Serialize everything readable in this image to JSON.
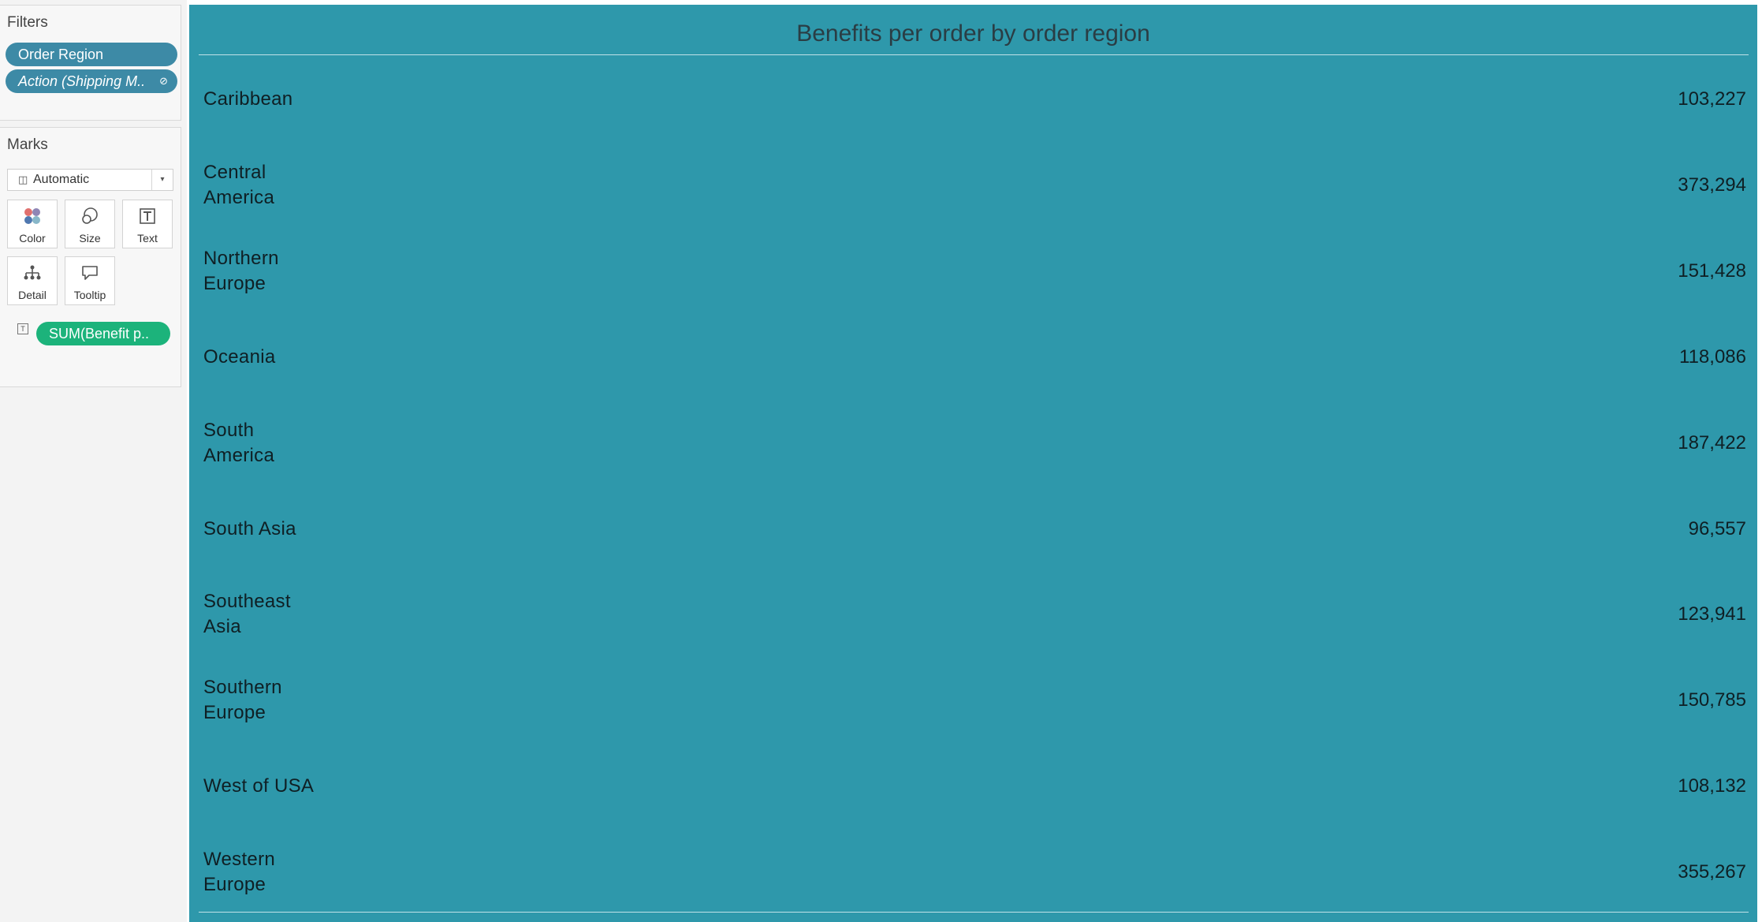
{
  "filters": {
    "title": "Filters",
    "pills": [
      {
        "label": "Order Region"
      },
      {
        "label": "Action (Shipping M..",
        "link_glyph": "⊘"
      }
    ]
  },
  "marks": {
    "title": "Marks",
    "mark_type": "Automatic",
    "buttons": [
      {
        "label": "Color",
        "icon": "color-dots-icon"
      },
      {
        "label": "Size",
        "icon": "size-circles-icon"
      },
      {
        "label": "Text",
        "icon": "text-t-icon"
      },
      {
        "label": "Detail",
        "icon": "detail-tree-icon"
      },
      {
        "label": "Tooltip",
        "icon": "tooltip-speech-icon"
      }
    ],
    "field_pill": "SUM(Benefit p.."
  },
  "colors": {
    "view_background": "#2e98ab",
    "filter_pill": "#3d8aa6",
    "measure_pill": "#1cb37b"
  },
  "chart_data": {
    "type": "table",
    "title": "Benefits per order by order region",
    "rows": [
      {
        "region": "Caribbean",
        "value": "103,227"
      },
      {
        "region": "Central America",
        "value": "373,294"
      },
      {
        "region": "Northern Europe",
        "value": "151,428"
      },
      {
        "region": "Oceania",
        "value": "118,086"
      },
      {
        "region": "South America",
        "value": "187,422"
      },
      {
        "region": "South Asia",
        "value": "96,557"
      },
      {
        "region": "Southeast Asia",
        "value": "123,941"
      },
      {
        "region": "Southern Europe",
        "value": "150,785"
      },
      {
        "region": "West of USA",
        "value": "108,132"
      },
      {
        "region": "Western Europe",
        "value": "355,267"
      }
    ]
  }
}
